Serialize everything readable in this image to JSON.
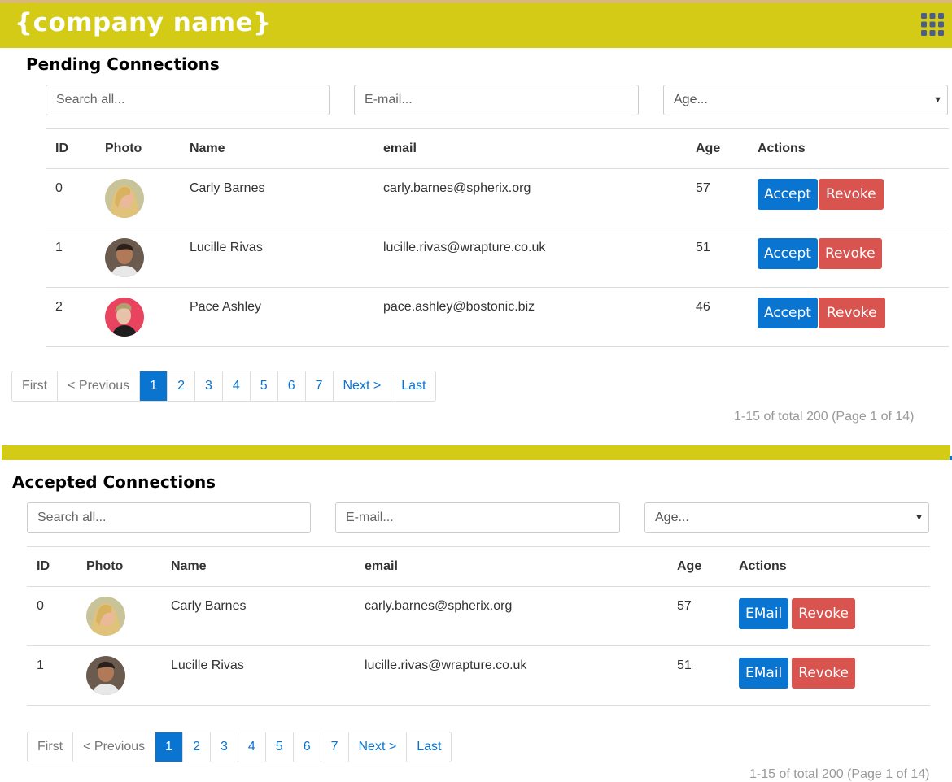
{
  "header": {
    "brand": "{company name}",
    "apps_icon": "apps-grid-icon"
  },
  "colors": {
    "header_bg": "#d4cb17",
    "primary": "#0a74d1",
    "danger": "#d9534f"
  },
  "pending": {
    "title": "Pending Connections",
    "search_placeholder": "Search all...",
    "email_placeholder": "E-mail...",
    "age_select": "Age...",
    "columns": [
      "ID",
      "Photo",
      "Name",
      "email",
      "Age",
      "Actions"
    ],
    "rows": [
      {
        "id": "0",
        "name": "Carly Barnes",
        "email": "carly.barnes@spherix.org",
        "age": "57",
        "primary_action": "Accept",
        "secondary_action": "Revoke"
      },
      {
        "id": "1",
        "name": "Lucille Rivas",
        "email": "lucille.rivas@wrapture.co.uk",
        "age": "51",
        "primary_action": "Accept",
        "secondary_action": "Revoke"
      },
      {
        "id": "2",
        "name": "Pace Ashley",
        "email": "pace.ashley@bostonic.biz",
        "age": "46",
        "primary_action": "Accept",
        "secondary_action": "Revoke"
      }
    ],
    "pagination": {
      "first": "First",
      "previous": "< Previous",
      "pages": [
        "1",
        "2",
        "3",
        "4",
        "5",
        "6",
        "7"
      ],
      "active": "1",
      "next": "Next >",
      "last": "Last"
    },
    "summary": "1-15 of total 200 (Page 1 of 14)"
  },
  "accepted": {
    "title": "Accepted Connections",
    "search_placeholder": "Search all...",
    "email_placeholder": "E-mail...",
    "age_select": "Age...",
    "columns": [
      "ID",
      "Photo",
      "Name",
      "email",
      "Age",
      "Actions"
    ],
    "rows": [
      {
        "id": "0",
        "name": "Carly Barnes",
        "email": "carly.barnes@spherix.org",
        "age": "57",
        "primary_action": "EMail",
        "secondary_action": "Revoke"
      },
      {
        "id": "1",
        "name": "Lucille Rivas",
        "email": "lucille.rivas@wrapture.co.uk",
        "age": "51",
        "primary_action": "EMail",
        "secondary_action": "Revoke"
      }
    ],
    "pagination": {
      "first": "First",
      "previous": "< Previous",
      "pages": [
        "1",
        "2",
        "3",
        "4",
        "5",
        "6",
        "7"
      ],
      "active": "1",
      "next": "Next >",
      "last": "Last"
    },
    "summary": "1-15 of total 200 (Page 1 of 14)"
  }
}
